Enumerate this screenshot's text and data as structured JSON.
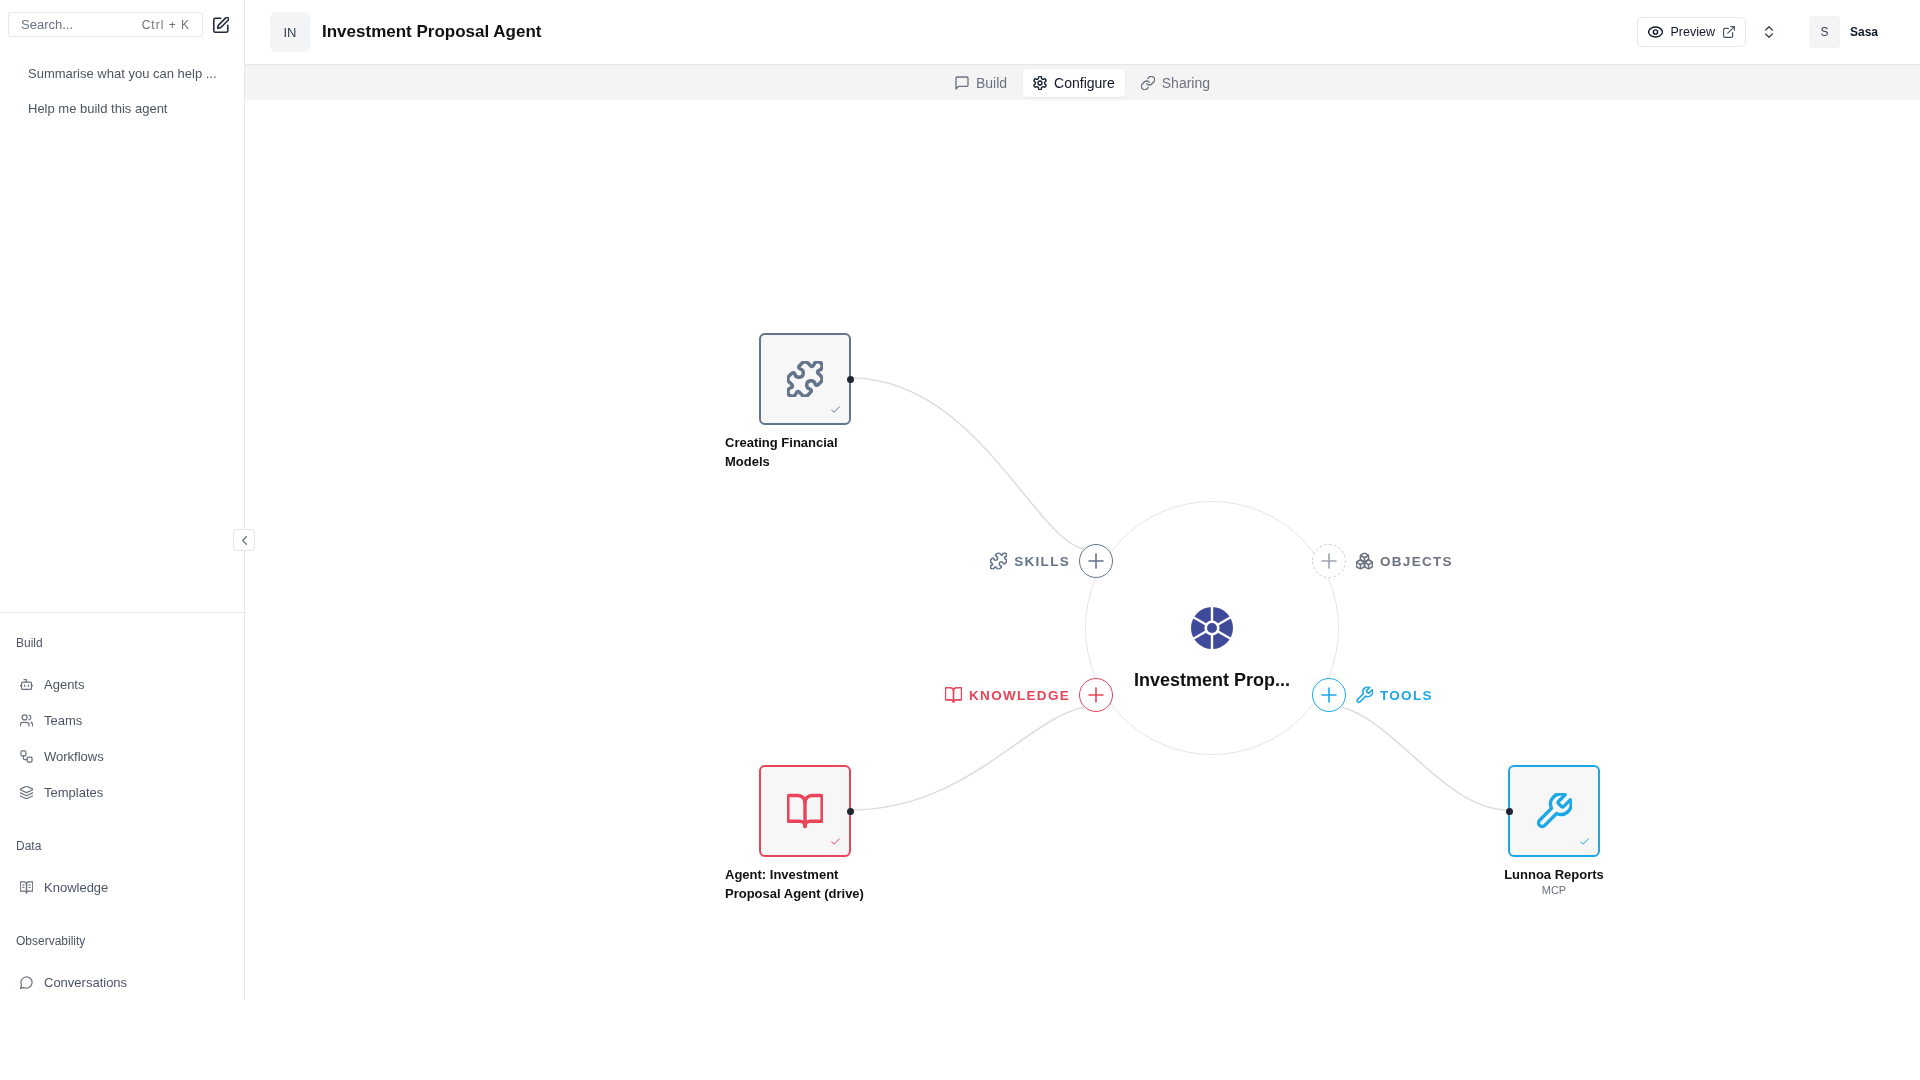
{
  "sidebar": {
    "search": {
      "placeholder": "Search...",
      "shortcut": "Ctrl + K"
    },
    "chats": [
      {
        "title": "Summarise what you can help ..."
      },
      {
        "title": "Help me build this agent"
      }
    ],
    "sections": [
      {
        "title": "Build",
        "items": [
          {
            "label": "Agents",
            "kind": "agents",
            "selected": false
          },
          {
            "label": "Teams",
            "kind": "teams",
            "selected": false
          },
          {
            "label": "Workflows",
            "kind": "workflows",
            "selected": false
          },
          {
            "label": "Templates",
            "kind": "templates",
            "selected": false
          }
        ]
      },
      {
        "title": "Data",
        "items": [
          {
            "label": "Knowledge",
            "kind": "knowledge",
            "selected": false
          }
        ]
      },
      {
        "title": "Observability",
        "items": [
          {
            "label": "Conversations",
            "kind": "conversations",
            "selected": false
          }
        ]
      }
    ]
  },
  "header": {
    "avatar": "IN",
    "title": "Investment Proposal Agent",
    "preview_button": "Preview",
    "user": {
      "initial": "S",
      "name": "Sasa"
    }
  },
  "tabs": [
    {
      "label": "Build",
      "kind": "build",
      "selected": false
    },
    {
      "label": "Configure",
      "kind": "configure",
      "selected": true
    },
    {
      "label": "Sharing",
      "kind": "sharing",
      "selected": false
    }
  ],
  "canvas": {
    "agent": {
      "name": "Investment Prop..."
    },
    "ports": [
      {
        "kind": "skills",
        "label": "SKILLS",
        "color": "#64748b",
        "connected": true
      },
      {
        "kind": "objects",
        "label": "OBJECTS",
        "color": "#6b7280",
        "connected": false
      },
      {
        "kind": "knowledge",
        "label": "KNOWLEDGE",
        "color": "#e8445a",
        "connected": true
      },
      {
        "kind": "tools",
        "label": "TOOLS",
        "color": "#1ea7e6",
        "connected": true
      }
    ],
    "nodes": [
      {
        "kind": "skill",
        "title": "Creating Financial Models",
        "color": "#64748b",
        "checked": true
      },
      {
        "kind": "knowledge",
        "title": "Agent: Investment Proposal Agent (drive)",
        "color": "#e8445a",
        "checked": true
      },
      {
        "kind": "tool",
        "title": "Lunnoa Reports",
        "subtitle": "MCP",
        "color": "#1ea7e6",
        "checked": true
      }
    ]
  }
}
